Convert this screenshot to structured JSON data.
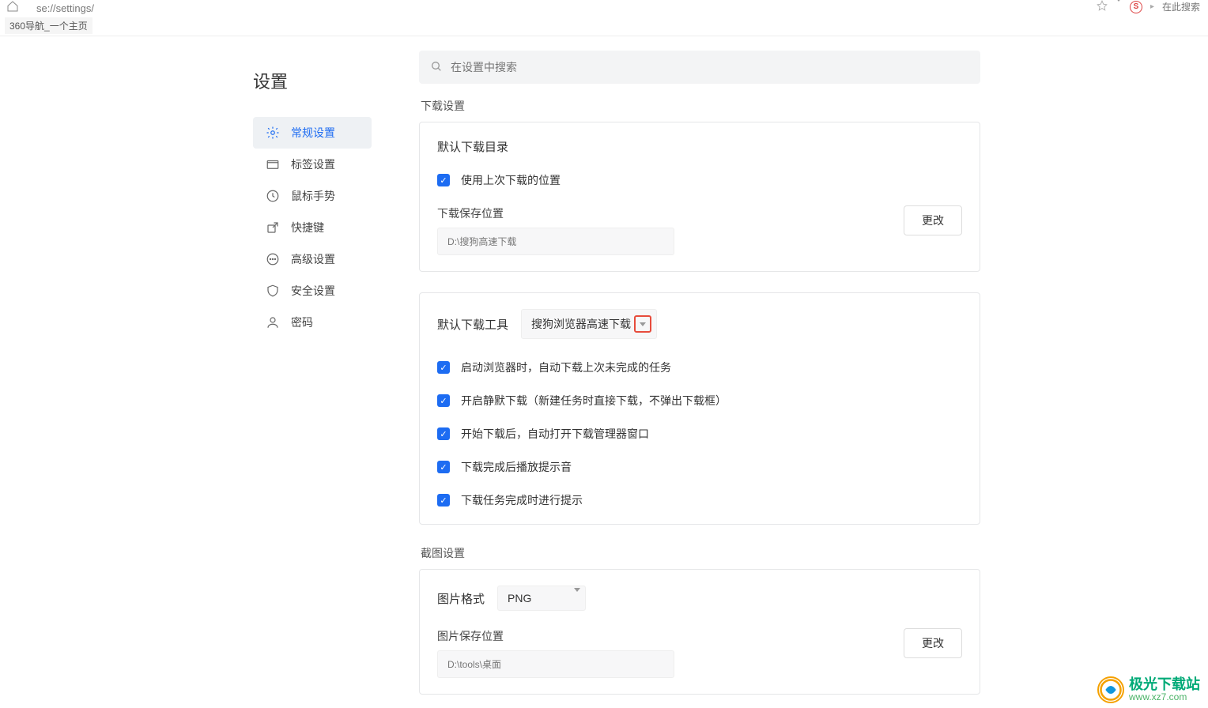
{
  "browser": {
    "url": "se://settings/",
    "bookmark": "360导航_一个主页",
    "search_placeholder": "在此搜索",
    "sogou_badge": "S"
  },
  "page_title": "设置",
  "search_placeholder": "在设置中搜索",
  "sidebar": {
    "items": [
      {
        "label": "常规设置"
      },
      {
        "label": "标签设置"
      },
      {
        "label": "鼠标手势"
      },
      {
        "label": "快捷键"
      },
      {
        "label": "高级设置"
      },
      {
        "label": "安全设置"
      },
      {
        "label": "密码"
      }
    ]
  },
  "download": {
    "section_title": "下载设置",
    "default_dir_heading": "默认下载目录",
    "use_last_location": "使用上次下载的位置",
    "save_location_label": "下载保存位置",
    "save_location_path": "D:\\搜狗高速下载",
    "change_btn": "更改",
    "default_tool_label": "默认下载工具",
    "default_tool_value": "搜狗浏览器高速下载",
    "opts": [
      "启动浏览器时，自动下载上次未完成的任务",
      "开启静默下载（新建任务时直接下载，不弹出下载框）",
      "开始下载后，自动打开下载管理器窗口",
      "下载完成后播放提示音",
      "下载任务完成时进行提示"
    ]
  },
  "screenshot": {
    "section_title": "截图设置",
    "format_label": "图片格式",
    "format_value": "PNG",
    "save_location_label": "图片保存位置",
    "save_location_path": "D:\\tools\\桌面",
    "change_btn": "更改"
  },
  "watermark": {
    "brand": "极光下载站",
    "url": "www.xz7.com"
  }
}
